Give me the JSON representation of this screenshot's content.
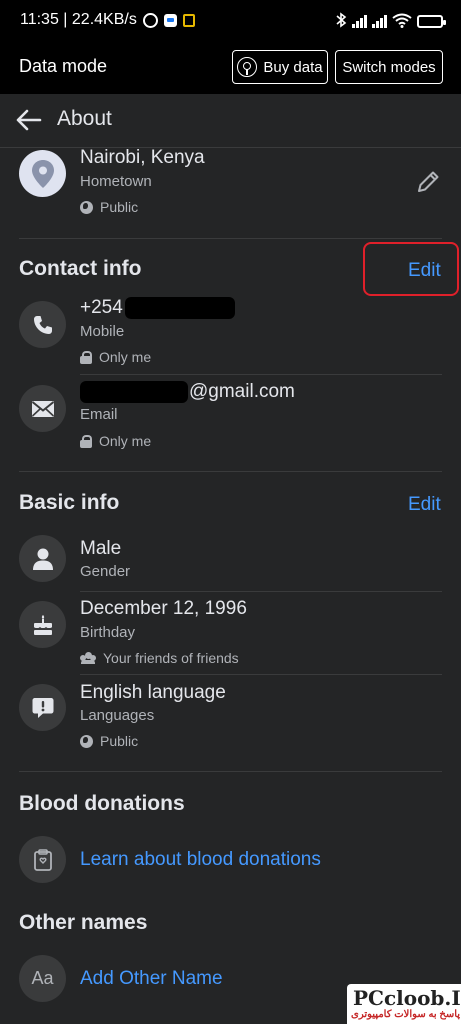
{
  "status_bar": {
    "time_speed": "11:35 | 22.4KB/s",
    "battery_level": 0.3
  },
  "data_bar": {
    "title": "Data mode",
    "buy_data": "Buy data",
    "switch_modes": "Switch modes"
  },
  "header": {
    "title": "About"
  },
  "hometown": {
    "value": "Nairobi, Kenya",
    "label": "Hometown",
    "privacy": "Public"
  },
  "contact": {
    "title": "Contact info",
    "edit": "Edit",
    "phone": {
      "value": "+254",
      "label": "Mobile",
      "privacy": "Only me"
    },
    "email": {
      "value": "@gmail.com",
      "label": "Email",
      "privacy": "Only me"
    }
  },
  "basic": {
    "title": "Basic info",
    "edit": "Edit",
    "gender": {
      "value": "Male",
      "label": "Gender"
    },
    "birthday": {
      "value": "December 12, 1996",
      "label": "Birthday",
      "privacy": "Your friends of friends"
    },
    "language": {
      "value": "English language",
      "label": "Languages",
      "privacy": "Public"
    }
  },
  "blood": {
    "title": "Blood donations",
    "link": "Learn about blood donations"
  },
  "other_names": {
    "title": "Other names",
    "icon_text": "Aa",
    "link": "Add Other Name"
  },
  "watermark": {
    "line1": "PCcloob.Ir",
    "line2": "پاسخ به سوالات کامپیوتری"
  },
  "colors": {
    "accent_link": "#4599ff",
    "highlight_box": "#e0202a",
    "background": "#242526"
  }
}
